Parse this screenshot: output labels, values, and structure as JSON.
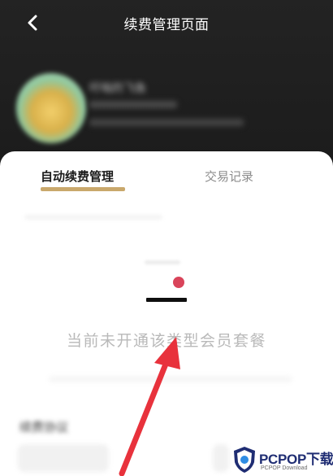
{
  "header": {
    "title": "续费管理页面",
    "back_icon": "chevron-left-icon",
    "user": {
      "name": "吁嗡的飞鱼"
    }
  },
  "tabs": [
    {
      "label": "自动续费管理",
      "active": true
    },
    {
      "label": "交易记录",
      "active": false
    }
  ],
  "empty_state": {
    "message": "当前未开通该类型会员套餐"
  },
  "section": {
    "label": "续费协议"
  },
  "watermark": {
    "main": "PCPOP下载",
    "sub": "PCPOP Download"
  },
  "colors": {
    "header_bg": "#1e1e1e",
    "tab_accent": "#c9a86c",
    "arrow": "#e8323c",
    "dot": "#d9445a",
    "watermark": "#1f2d73"
  }
}
